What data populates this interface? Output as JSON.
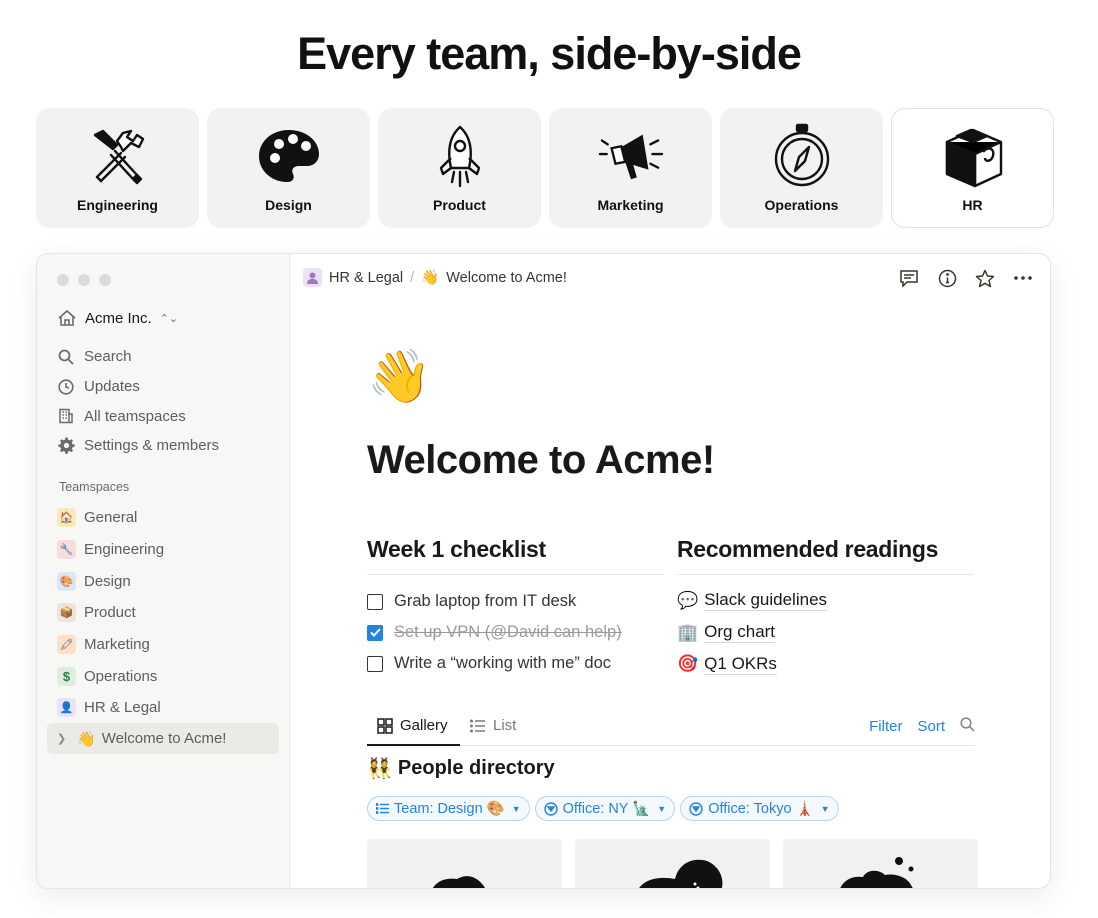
{
  "headline": "Every team, side-by-side",
  "teams": [
    {
      "label": "Engineering",
      "icon": "tools-icon"
    },
    {
      "label": "Design",
      "icon": "palette-icon"
    },
    {
      "label": "Product",
      "icon": "rocket-icon"
    },
    {
      "label": "Marketing",
      "icon": "megaphone-icon"
    },
    {
      "label": "Operations",
      "icon": "compass-icon"
    },
    {
      "label": "HR",
      "icon": "puzzle-icon",
      "active": true
    }
  ],
  "sidebar": {
    "workspace": "Acme Inc.",
    "nav": [
      {
        "label": "Search",
        "icon": "search-icon"
      },
      {
        "label": "Updates",
        "icon": "clock-icon"
      },
      {
        "label": "All teamspaces",
        "icon": "building-icon"
      },
      {
        "label": "Settings & members",
        "icon": "gear-icon"
      }
    ],
    "teamspaces_title": "Teamspaces",
    "teamspaces": [
      {
        "label": "General",
        "badge": "🏠",
        "bg": "#fbe9b7"
      },
      {
        "label": "Engineering",
        "badge": "🔧",
        "bg": "#f9dcd9"
      },
      {
        "label": "Design",
        "badge": "🎨",
        "bg": "#d9e7f8"
      },
      {
        "label": "Product",
        "badge": "📦",
        "bg": "#efe3dc"
      },
      {
        "label": "Marketing",
        "badge": "🖍",
        "bg": "#fbe0cc"
      },
      {
        "label": "Operations",
        "badge": "$",
        "bg": "#dcefdf"
      },
      {
        "label": "HR & Legal",
        "badge": "👤",
        "bg": "#ebe3f3"
      }
    ],
    "active_page": {
      "label": "Welcome to Acme!",
      "emoji": "👋"
    }
  },
  "topbar": {
    "crumb_1": "HR & Legal",
    "crumb_sep": "/",
    "crumb_2_emoji": "👋",
    "crumb_2": "Welcome to Acme!"
  },
  "page": {
    "emoji": "👋",
    "title": "Welcome to Acme!",
    "checklist_title": "Week 1 checklist",
    "checklist": [
      {
        "label": "Grab laptop from IT desk",
        "checked": false
      },
      {
        "label": "Set up VPN (@David can help)",
        "checked": true
      },
      {
        "label": "Write a “working with me” doc",
        "checked": false
      }
    ],
    "readings_title": "Recommended readings",
    "readings": [
      {
        "emoji": "💬",
        "label": "Slack guidelines"
      },
      {
        "emoji": "🏢",
        "label": "Org chart"
      },
      {
        "emoji": "🎯",
        "label": "Q1 OKRs"
      }
    ],
    "view_tabs": [
      {
        "label": "Gallery",
        "icon": "gallery-icon",
        "active": true
      },
      {
        "label": "List",
        "icon": "list-icon",
        "active": false
      }
    ],
    "filter_label": "Filter",
    "sort_label": "Sort",
    "directory_emoji": "👯",
    "directory_title": "People directory",
    "chips": [
      {
        "label": "Team: Design 🎨",
        "icon": "list-icon"
      },
      {
        "label": "Office: NY 🗽",
        "icon": "filter-circle-icon"
      },
      {
        "label": "Office: Tokyo 🗼",
        "icon": "filter-circle-icon"
      }
    ]
  },
  "colors": {
    "accent": "#2383e2",
    "sidebar_bg": "#f7f7f5",
    "card_bg": "#f3f2f0"
  }
}
